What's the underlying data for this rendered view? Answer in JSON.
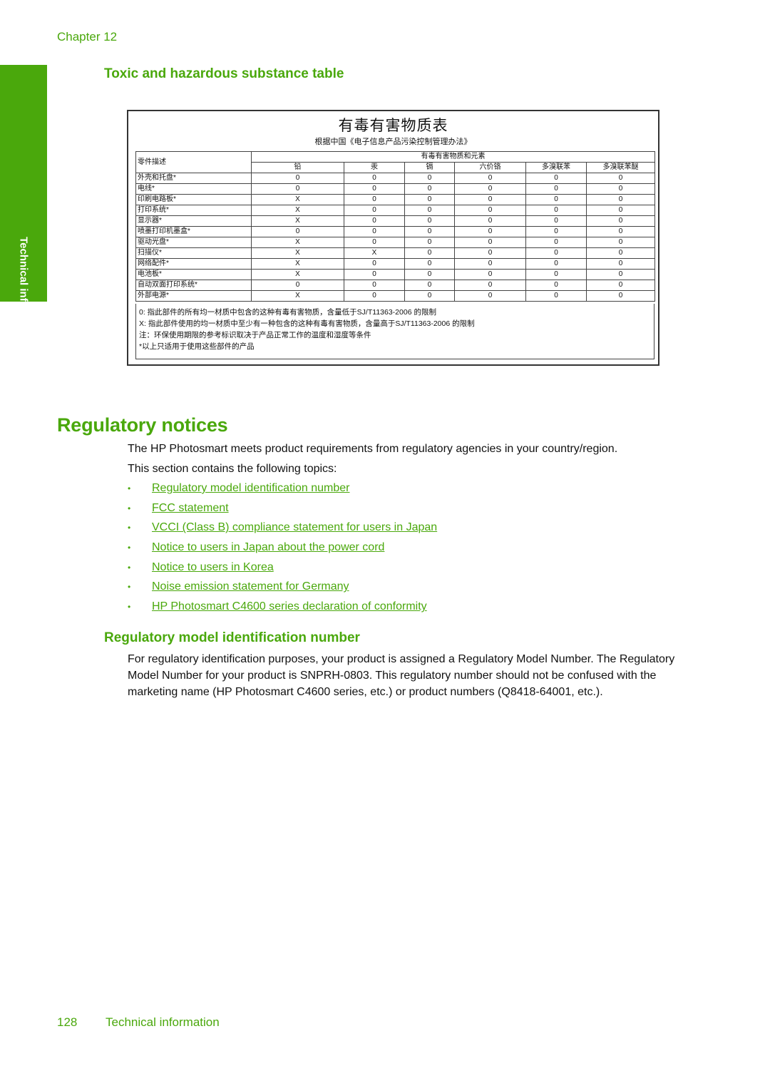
{
  "header": {
    "chapter": "Chapter 12"
  },
  "side_tab": {
    "label": "Technical information"
  },
  "sections": {
    "toxic_heading": "Toxic and hazardous substance table",
    "regulatory_heading": "Regulatory notices",
    "model_id_heading": "Regulatory model identification number"
  },
  "substance_table": {
    "title": "有毒有害物质表",
    "subtitle": "根据中国《电子信息产品污染控制管理办法》",
    "part_header": "零件描述",
    "group_header": "有毒有害物质和元素",
    "columns": [
      "铅",
      "汞",
      "镉",
      "六价铬",
      "多溴联苯",
      "多溴联苯醚"
    ],
    "rows": [
      {
        "part": "外壳和托盘*",
        "values": [
          "0",
          "0",
          "0",
          "0",
          "0",
          "0"
        ]
      },
      {
        "part": "电线*",
        "values": [
          "0",
          "0",
          "0",
          "0",
          "0",
          "0"
        ]
      },
      {
        "part": "印刷电路板*",
        "values": [
          "X",
          "0",
          "0",
          "0",
          "0",
          "0"
        ]
      },
      {
        "part": "打印系统*",
        "values": [
          "X",
          "0",
          "0",
          "0",
          "0",
          "0"
        ]
      },
      {
        "part": "显示器*",
        "values": [
          "X",
          "0",
          "0",
          "0",
          "0",
          "0"
        ]
      },
      {
        "part": "喷墨打印机墨盒*",
        "values": [
          "0",
          "0",
          "0",
          "0",
          "0",
          "0"
        ]
      },
      {
        "part": "驱动光盘*",
        "values": [
          "X",
          "0",
          "0",
          "0",
          "0",
          "0"
        ]
      },
      {
        "part": "扫描仪*",
        "values": [
          "X",
          "X",
          "0",
          "0",
          "0",
          "0"
        ]
      },
      {
        "part": "网络配件*",
        "values": [
          "X",
          "0",
          "0",
          "0",
          "0",
          "0"
        ]
      },
      {
        "part": "电池板*",
        "values": [
          "X",
          "0",
          "0",
          "0",
          "0",
          "0"
        ]
      },
      {
        "part": "自动双面打印系统*",
        "values": [
          "0",
          "0",
          "0",
          "0",
          "0",
          "0"
        ]
      },
      {
        "part": "外部电源*",
        "values": [
          "X",
          "0",
          "0",
          "0",
          "0",
          "0"
        ]
      }
    ],
    "notes": [
      "0: 指此部件的所有均一材质中包含的这种有毒有害物质，含量低于SJ/T11363-2006 的限制",
      "X: 指此部件使用的均一材质中至少有一种包含的这种有毒有害物质，含量高于SJ/T11363-2006 的限制",
      "注：环保使用期限的参考标识取决于产品正常工作的温度和湿度等条件",
      "*以上只适用于使用这些部件的产品"
    ]
  },
  "regulatory": {
    "intro": "The HP Photosmart meets product requirements from regulatory agencies in your country/region.",
    "topics_intro": "This section contains the following topics:",
    "bullet": "•",
    "topics": [
      "Regulatory model identification number",
      "FCC statement",
      "VCCI (Class B) compliance statement for users in Japan",
      "Notice to users in Japan about the power cord",
      "Notice to users in Korea",
      "Noise emission statement for Germany",
      "HP Photosmart C4600 series declaration of conformity"
    ],
    "model_id_paragraph": "For regulatory identification purposes, your product is assigned a Regulatory Model Number. The Regulatory Model Number for your product is SNPRH-0803. This regulatory number should not be confused with the marketing name (HP Photosmart C4600 series, etc.) or product numbers (Q8418-64001, etc.)."
  },
  "footer": {
    "page_number": "128",
    "section": "Technical information"
  },
  "colors": {
    "accent": "#4aa80c",
    "text": "#111111"
  }
}
